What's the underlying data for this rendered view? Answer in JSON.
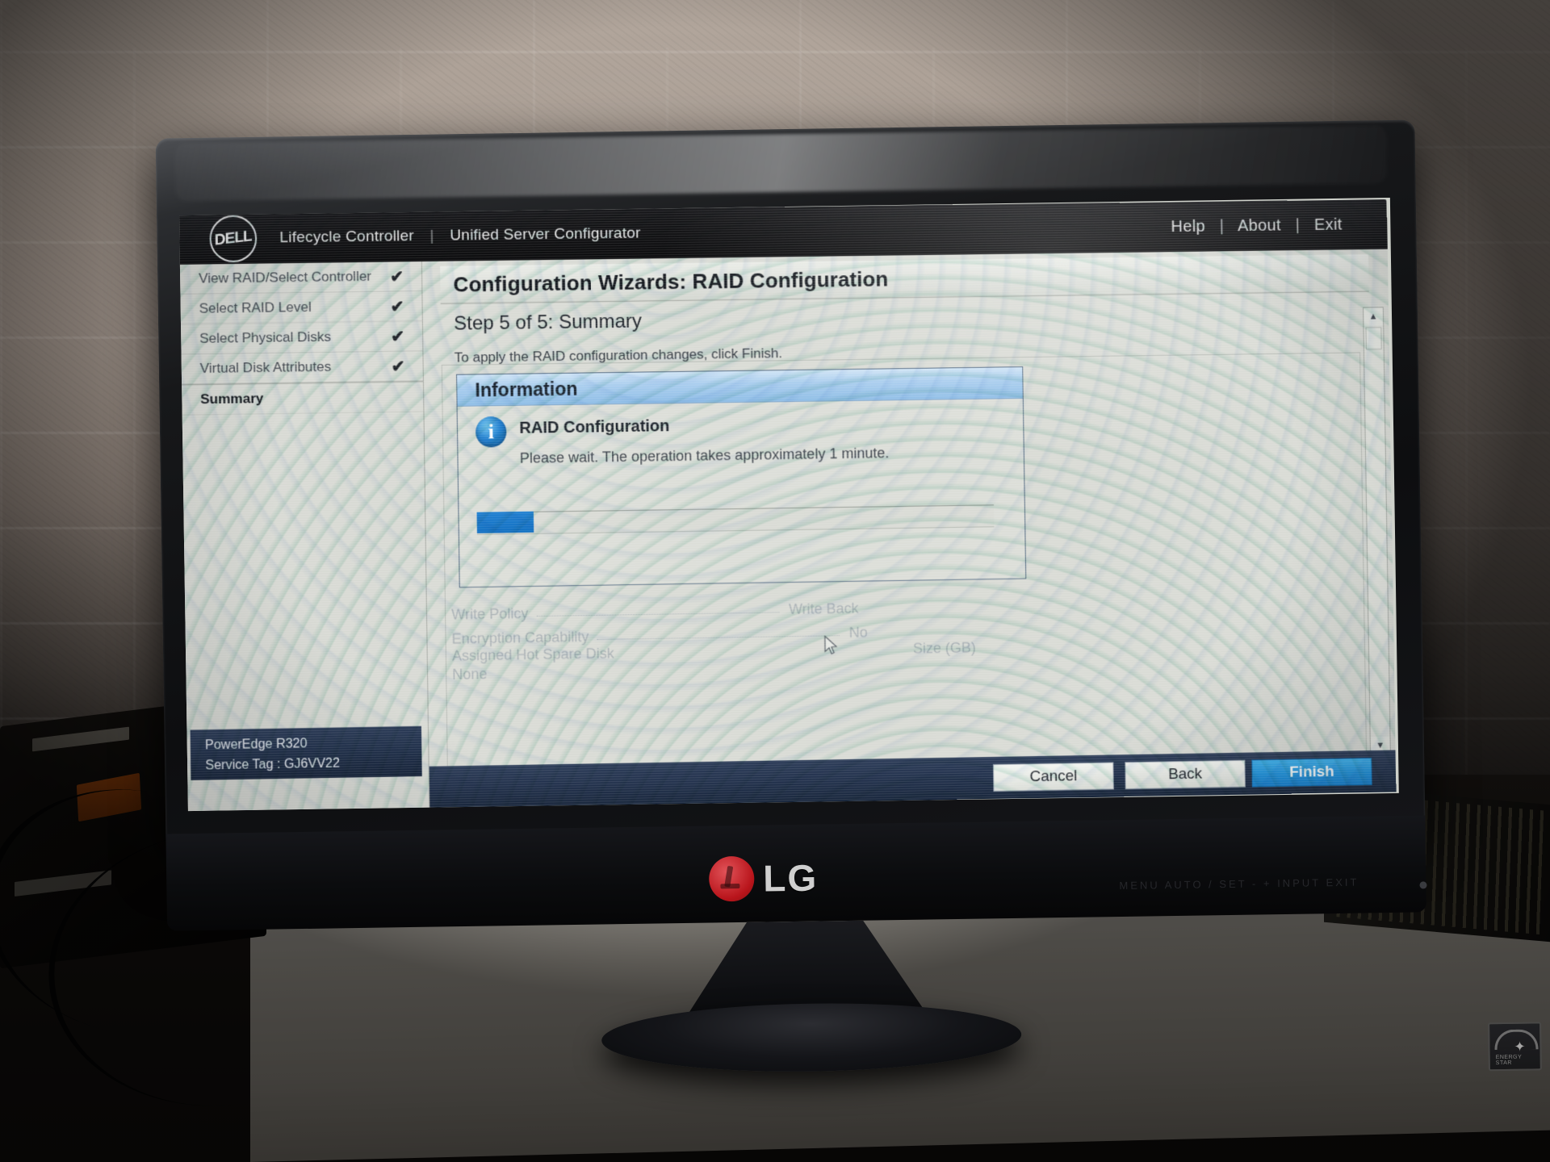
{
  "photo": {
    "monitor_brand": "LG",
    "energy_star_label": "ENERGY STAR",
    "osd_hint": "MENU  AUTO / SET  -  +  INPUT  EXIT"
  },
  "header": {
    "logo_text": "DELL",
    "product": "Lifecycle Controller",
    "separator": "|",
    "module": "Unified Server Configurator",
    "links": [
      "Help",
      "About",
      "Exit"
    ],
    "link_separator": "|"
  },
  "sidebar": {
    "items": [
      {
        "label": "View RAID/Select Controller",
        "check": "✔",
        "done": true,
        "active": false
      },
      {
        "label": "Select RAID Level",
        "check": "✔",
        "done": true,
        "active": false
      },
      {
        "label": "Select Physical Disks",
        "check": "✔",
        "done": true,
        "active": false
      },
      {
        "label": "Virtual Disk Attributes",
        "check": "✔",
        "done": true,
        "active": false
      },
      {
        "label": "Summary",
        "check": "",
        "done": false,
        "active": true
      }
    ],
    "system": {
      "model": "PowerEdge R320",
      "service_tag": "Service Tag : GJ6VV22"
    }
  },
  "main": {
    "page_title": "Configuration Wizards: RAID Configuration",
    "step": "Step 5 of 5: Summary",
    "instruction": "To apply the RAID configuration changes, click Finish.",
    "information_panel": {
      "header": "Information",
      "icon": "info-icon",
      "title": "RAID Configuration",
      "message": "Please wait. The operation takes approximately 1 minute.",
      "progress_percent": 11
    },
    "summary_rows": [
      {
        "label": "Write Policy",
        "value": "Write Back"
      },
      {
        "label": "Encryption Capability",
        "value": "No"
      }
    ],
    "hot_spare": {
      "label": "Assigned Hot Spare Disk",
      "value": "None"
    },
    "size_column": "Size (GB)",
    "scrollbar": {
      "up": "▲",
      "down": "▼"
    }
  },
  "footer": {
    "cancel": "Cancel",
    "back": "Back",
    "finish": "Finish"
  },
  "colors": {
    "accent_blue": "#1f8ad8",
    "progress_blue": "#1573c6",
    "panel_header_blue": "#8ebde6",
    "footer_navy": "#22314c",
    "screen_bg": "#d9dbd5"
  }
}
